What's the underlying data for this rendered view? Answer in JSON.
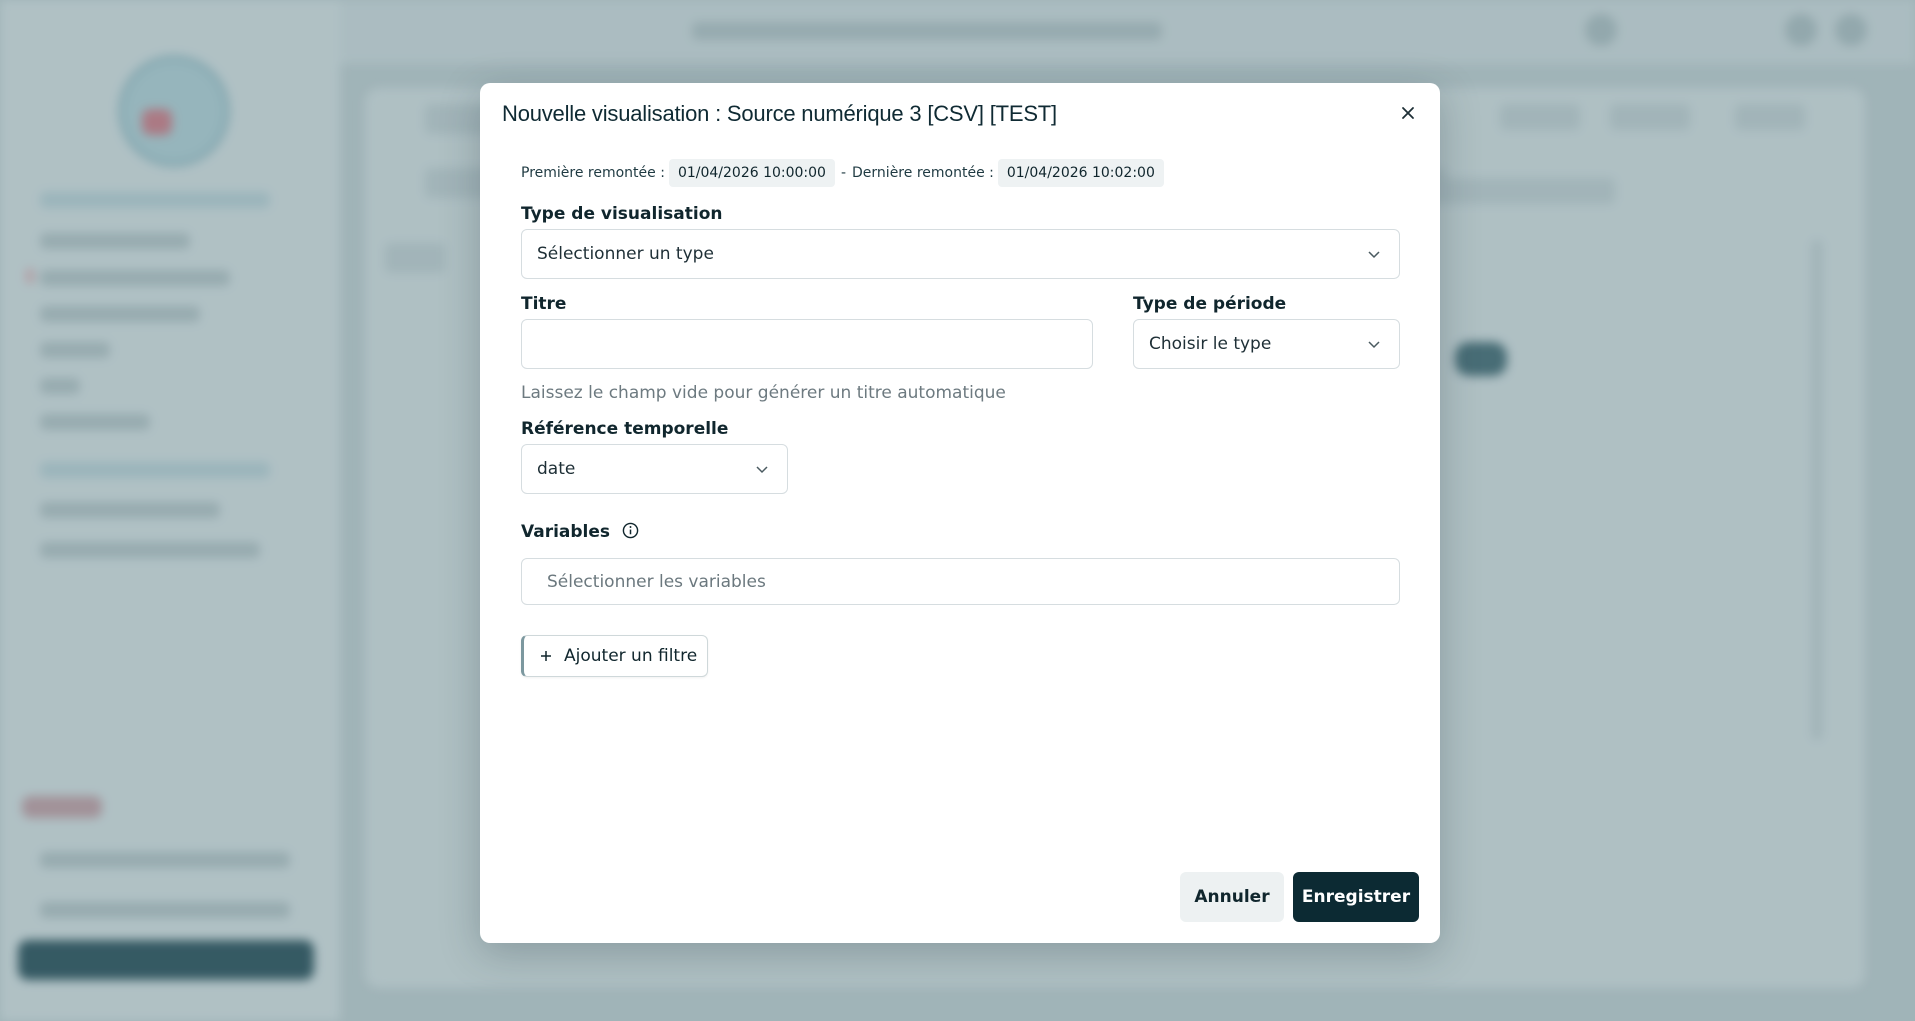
{
  "modal": {
    "title": "Nouvelle visualisation : Source numérique 3 [CSV] [TEST]",
    "dates": {
      "first_label": "Première remontée :",
      "first_value": "01/04/2026 10:00:00",
      "separator": "-",
      "last_label": "Dernière remontée :",
      "last_value": "01/04/2026 10:02:00"
    },
    "visualisation_type": {
      "label": "Type de visualisation",
      "value": "Sélectionner un type"
    },
    "title_field": {
      "label": "Titre",
      "value": "",
      "hint": "Laissez le champ vide pour générer un titre automatique"
    },
    "period_type": {
      "label": "Type de période",
      "value": "Choisir le type"
    },
    "time_reference": {
      "label": "Référence temporelle",
      "value": "date"
    },
    "variables": {
      "label": "Variables",
      "placeholder": "Sélectionner les variables"
    },
    "add_filter_label": "Ajouter un filtre",
    "cancel_label": "Annuler",
    "save_label": "Enregistrer"
  },
  "colors": {
    "primary": "#0c2a33",
    "cancel_bg": "#edf1f2",
    "chip_bg": "#eef2f3",
    "border": "#d6dde0"
  },
  "icons": {
    "close": "close-icon",
    "chevron": "chevron-down-icon",
    "info": "info-icon",
    "plus": "plus-icon"
  }
}
